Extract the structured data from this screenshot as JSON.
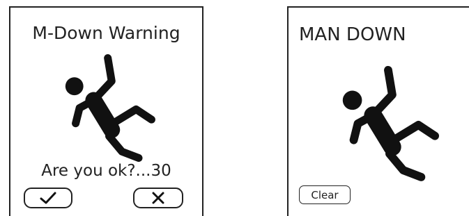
{
  "warning_screen": {
    "title": "M-Down Warning",
    "figure_icon": "falling-person-icon",
    "prompt_text": "Are you ok?...30",
    "confirm_icon": "checkmark-icon",
    "cancel_icon": "close-icon"
  },
  "mandown_screen": {
    "title": "MAN DOWN",
    "figure_icon": "falling-person-icon",
    "clear_label": "Clear"
  },
  "colors": {
    "ink": "#111111",
    "background": "#ffffff"
  }
}
